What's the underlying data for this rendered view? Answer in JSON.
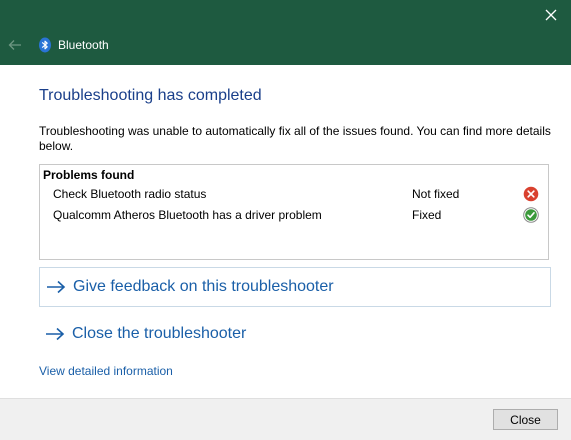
{
  "window": {
    "title": "Bluetooth",
    "titlebar_color": "#1e5a40"
  },
  "main": {
    "heading": "Troubleshooting has completed",
    "description": "Troubleshooting was unable to automatically fix all of the issues found. You can find more details below.",
    "problems": {
      "header": "Problems found",
      "rows": [
        {
          "name": "Check Bluetooth radio status",
          "status": "Not fixed",
          "icon": "error-icon",
          "icon_color": "#d9412f"
        },
        {
          "name": "Qualcomm Atheros Bluetooth has a driver problem",
          "status": "Fixed",
          "icon": "check-icon",
          "icon_color": "#3c9a3c"
        }
      ]
    },
    "links": {
      "feedback": "Give feedback on this troubleshooter",
      "close_troubleshooter": "Close the troubleshooter",
      "view_details": "View detailed information"
    },
    "link_color": "#1a5fa8"
  },
  "footer": {
    "close_label": "Close"
  }
}
